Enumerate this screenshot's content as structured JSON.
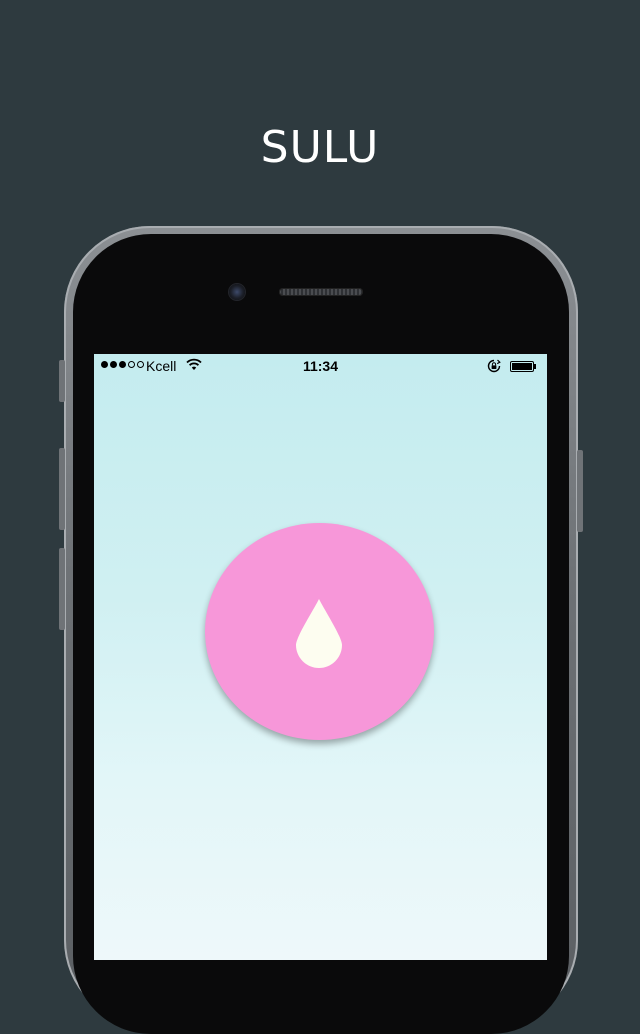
{
  "promo": {
    "title": "SULU"
  },
  "status_bar": {
    "signal_strength": 3,
    "signal_max": 5,
    "carrier": "Kcell",
    "wifi_icon": "wifi-icon",
    "time": "11:34",
    "rotation_lock_icon": "rotation-lock-icon",
    "battery_level": 1.0
  },
  "main": {
    "button_icon": "water-drop-icon",
    "button_color": "#f797d9",
    "drop_color": "#fdfdf0"
  },
  "colors": {
    "background": "#2e3a3f",
    "screen_top": "#c4ecef",
    "screen_bottom": "#eef8fa"
  }
}
